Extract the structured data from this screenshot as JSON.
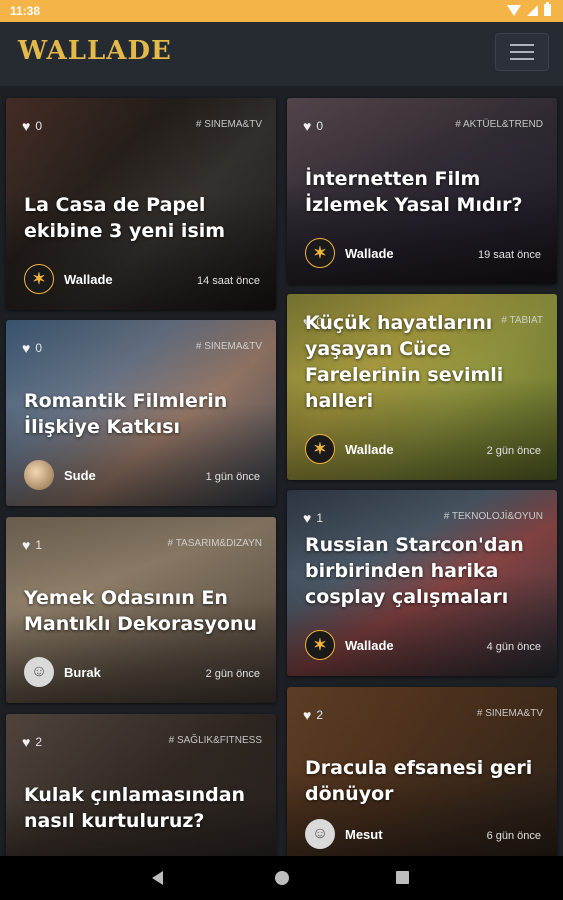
{
  "status_bar": {
    "time": "11:38"
  },
  "app_bar": {
    "logo": "WALLADE"
  },
  "cards": [
    {
      "likes": "0",
      "tag": "# SINEMA&TV",
      "title": "La Casa de Papel ekibine 3 yeni isim",
      "author": "Wallade",
      "time": "14 saat önce",
      "bg": "linear-gradient(135deg,#5a3a30 0%,#2e2621 35%,#3f3a36 60%,#1d1a18 100%)"
    },
    {
      "likes": "0",
      "tag": "# AKTÜEL&TREND",
      "title": "İnternetten Film İzlemek Yasal Mıdır?",
      "author": "Wallade",
      "time": "19 saat önce",
      "bg": "linear-gradient(160deg,#6e5a63 0%,#3d3540 40%,#2c2532 70%,#1b1820 100%)"
    },
    {
      "likes": "0",
      "tag": "# SINEMA&TV",
      "title": "Romantik Filmlerin İlişkiye Katkısı",
      "author": "Sude",
      "time": "1 gün önce",
      "bg": "linear-gradient(140deg,#4a6e8f 0%,#7c8aa0 35%,#b08c78 60%,#3b4858 100%)"
    },
    {
      "likes": "0",
      "tag": "# TABIAT",
      "title": "Küçük hayatlarını yaşayan Cüce Farelerinin sevimli halleri",
      "author": "Wallade",
      "time": "2 gün önce",
      "bg": "linear-gradient(135deg,#9a9640 0%,#c4b54a 35%,#aab04a 60%,#6d7a2e 100%)"
    },
    {
      "likes": "1",
      "tag": "# TASARIM&DIZAYN",
      "title": "Yemek Odasının En Mantıklı Dekorasyonu",
      "author": "Burak",
      "time": "2 gün önce",
      "bg": "linear-gradient(160deg,#8a7a66 0%,#a8957c 35%,#6e5f50 70%,#4a4038 100%)"
    },
    {
      "likes": "1",
      "tag": "# TEKNOLOJİ&OYUN",
      "title": "Russian Starcon'dan birbirinden harika cosplay çalışmaları",
      "author": "Wallade",
      "time": "4 gün önce",
      "bg": "linear-gradient(150deg,#3a4656 0%,#5a6a7a 35%,#a05050 55%,#2e3540 100%)"
    },
    {
      "likes": "2",
      "tag": "# SAĞLIK&FITNESS",
      "title": "Kulak çınlamasından nasıl kurtuluruz?",
      "author": "",
      "time": "",
      "bg": "linear-gradient(150deg,#6a5a50 0%,#3a302a 45%,#241f1c 100%)"
    },
    {
      "likes": "2",
      "tag": "# SINEMA&TV",
      "title": "Dracula efsanesi geri dönüyor",
      "author": "Mesut",
      "time": "6 gün önce",
      "bg": "linear-gradient(150deg,#7a5030 0%,#5a3a22 40%,#3a2a1e 75%,#2a1e16 100%)"
    }
  ]
}
